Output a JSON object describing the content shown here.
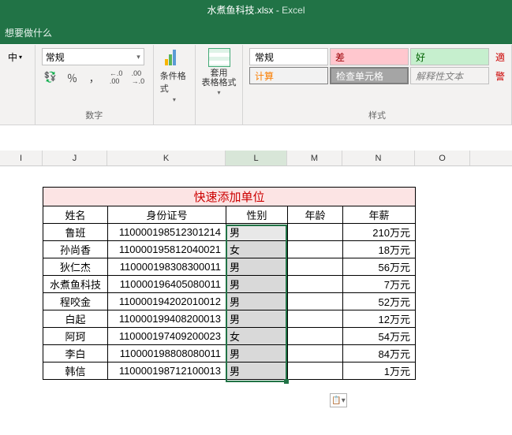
{
  "title": {
    "workbook": "水煮鱼科技.xlsx",
    "separator": "  -  ",
    "app": "Excel"
  },
  "tellme": "想要做什么",
  "ribbon": {
    "center_label": "中",
    "number_format": "常规",
    "pct": "％",
    "comma": "，",
    "dec_inc": ".00→.0",
    "dec_dec": ".0→.00",
    "group_number": "数字",
    "cond_fmt": "条件格式",
    "table_fmt": "套用\n表格格式",
    "group_styles": "样式",
    "styles": {
      "normal": "常规",
      "bad": "差",
      "good": "好",
      "calc": "计算",
      "check": "检查单元格",
      "explanatory": "解释性文本"
    }
  },
  "columns": [
    "I",
    "J",
    "K",
    "L",
    "M",
    "N",
    "O"
  ],
  "table": {
    "title": "快速添加单位",
    "headers": [
      "姓名",
      "身份证号",
      "性别",
      "年龄",
      "年薪"
    ],
    "rows": [
      {
        "name": "鲁班",
        "id": "110000198512301214",
        "gender": "男",
        "age": "",
        "salary": "210万元"
      },
      {
        "name": "孙尚香",
        "id": "110000195812040021",
        "gender": "女",
        "age": "",
        "salary": "18万元"
      },
      {
        "name": "狄仁杰",
        "id": "110000198308300011",
        "gender": "男",
        "age": "",
        "salary": "56万元"
      },
      {
        "name": "水煮鱼科技",
        "id": "110000196405080011",
        "gender": "男",
        "age": "",
        "salary": "7万元"
      },
      {
        "name": "程咬金",
        "id": "110000194202010012",
        "gender": "男",
        "age": "",
        "salary": "52万元"
      },
      {
        "name": "白起",
        "id": "110000199408200013",
        "gender": "男",
        "age": "",
        "salary": "12万元"
      },
      {
        "name": "阿珂",
        "id": "110000197409200023",
        "gender": "女",
        "age": "",
        "salary": "54万元"
      },
      {
        "name": "李白",
        "id": "110000198808080011",
        "gender": "男",
        "age": "",
        "salary": "84万元"
      },
      {
        "name": "韩信",
        "id": "110000198712100013",
        "gender": "男",
        "age": "",
        "salary": "1万元"
      }
    ]
  }
}
